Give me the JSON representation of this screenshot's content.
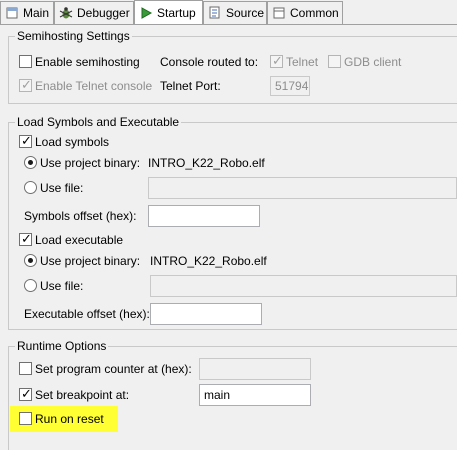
{
  "tabs": [
    {
      "label": "Main",
      "icon": "main-tab-icon"
    },
    {
      "label": "Debugger",
      "icon": "debugger-bug-icon"
    },
    {
      "label": "Startup",
      "icon": "startup-play-icon",
      "active": true
    },
    {
      "label": "Source",
      "icon": "source-lookup-icon"
    },
    {
      "label": "Common",
      "icon": "common-page-icon"
    }
  ],
  "semihosting": {
    "title": "Semihosting Settings",
    "enable_semihosting": "Enable semihosting",
    "enable_telnet_console": "Enable Telnet console",
    "console_routed_to": "Console routed to:",
    "telnet": "Telnet",
    "gdb_client": "GDB client",
    "telnet_port_label": "Telnet Port:",
    "telnet_port_value": "51794"
  },
  "load": {
    "title": "Load Symbols and Executable",
    "load_symbols": "Load symbols",
    "use_project_binary": "Use project binary:",
    "symbols_binary": "INTRO_K22_Robo.elf",
    "use_file": "Use file:",
    "symbols_offset": "Symbols offset (hex):",
    "load_executable": "Load executable",
    "executable_binary": "INTRO_K22_Robo.elf",
    "executable_offset": "Executable offset (hex):"
  },
  "runtime": {
    "title": "Runtime Options",
    "set_pc": "Set program counter at (hex):",
    "set_breakpoint": "Set breakpoint at:",
    "breakpoint_value": "main",
    "run_on_reset": "Run on reset"
  },
  "colors": {
    "highlight": "#ffff33",
    "active_tab": "#ffffff"
  }
}
